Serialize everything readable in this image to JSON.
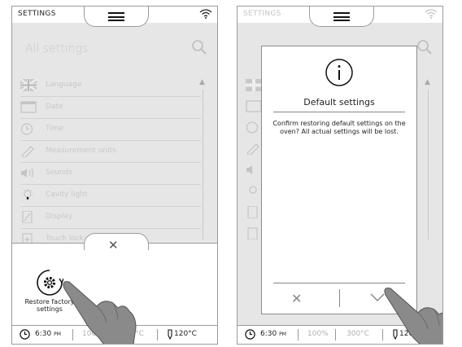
{
  "left": {
    "header_title": "SETTINGS",
    "search_placeholder": "All settings",
    "settings_items": [
      {
        "label": "Language",
        "icon": "flag-icon"
      },
      {
        "label": "Date",
        "icon": "calendar-icon"
      },
      {
        "label": "Time",
        "icon": "clock-icon"
      },
      {
        "label": "Measurement units",
        "icon": "ruler-icon"
      },
      {
        "label": "Sounds",
        "icon": "speaker-icon"
      },
      {
        "label": "Cavity light",
        "icon": "bulb-icon"
      },
      {
        "label": "Display",
        "icon": "display-icon"
      },
      {
        "label": "Touch lock",
        "icon": "lock-icon"
      }
    ],
    "panel_action_label": "Restore factory settings",
    "panel_close": "✕"
  },
  "right": {
    "header_title": "SETTINGS",
    "dialog": {
      "title": "Default settings",
      "message": "Confirm restoring default settings on the oven? All actual settings will be lost.",
      "cancel": "✕",
      "confirm_icon": "check-icon"
    }
  },
  "status": {
    "time": "6:30",
    "ampm": "PM",
    "percent": "100%",
    "temp_set": "300°C",
    "probe_temp": "120°C"
  },
  "colors": {
    "frame": "#9a9a9a",
    "screen_bg": "#e6e6e6",
    "text": "#222222",
    "faded": "#c8c8c8"
  }
}
